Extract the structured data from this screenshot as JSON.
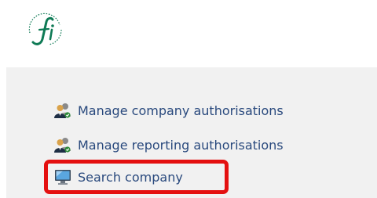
{
  "menu": {
    "items": [
      {
        "label": "Manage company authorisations",
        "icon": "users-icon"
      },
      {
        "label": "Manage reporting authorisations",
        "icon": "users-icon"
      },
      {
        "label": "Search company",
        "icon": "monitor-icon"
      }
    ]
  },
  "highlight": {
    "item_index": 2,
    "color": "#e41010"
  },
  "colors": {
    "link_text": "#29497d",
    "panel_background": "#f1f1f1",
    "logo_green": "#0e7a55"
  }
}
